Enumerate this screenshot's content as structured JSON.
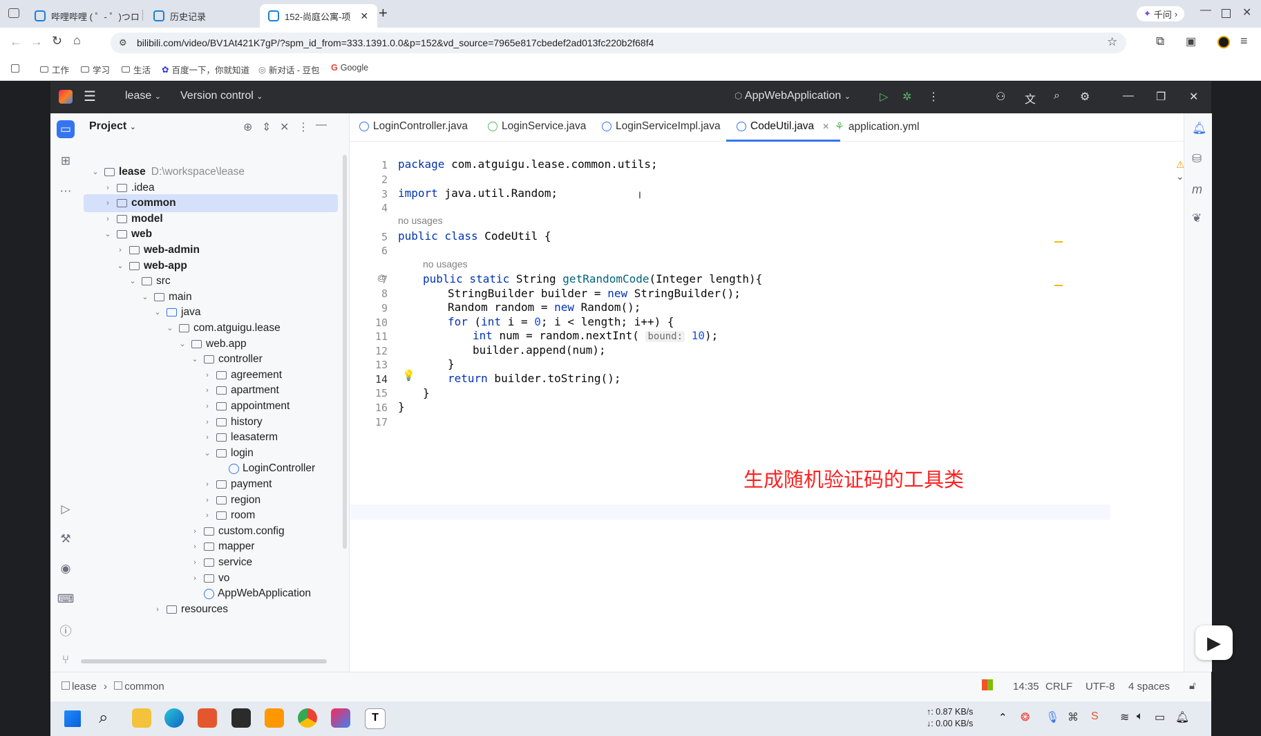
{
  "browser": {
    "tabs": [
      {
        "label": "哔哩哔哩 ( ゜- ゜)つロ",
        "active": false
      },
      {
        "label": "历史记录",
        "active": false
      },
      {
        "label": "152-尚庭公寓-项",
        "active": true
      }
    ],
    "new_tab": "+",
    "assistant_label": "千问",
    "url": "bilibili.com/video/BV1At421K7gP/?spm_id_from=333.1391.0.0&p=152&vd_source=7965e817cbedef2ad013fc220b2f68f4",
    "bookmarks": [
      "工作",
      "学习",
      "生活",
      "百度一下，你就知道",
      "新对话 - 豆包",
      "Google"
    ]
  },
  "ide": {
    "project_name": "lease",
    "vcs_label": "Version control",
    "run_config": "AppWebApplication",
    "project_panel_title": "Project",
    "tree": [
      {
        "label": "lease",
        "extra": "D:\\workspace\\lease",
        "depth": 0,
        "type": "module",
        "open": true,
        "bold": true
      },
      {
        "label": ".idea",
        "depth": 1,
        "type": "folder",
        "open": false
      },
      {
        "label": "common",
        "depth": 1,
        "type": "module",
        "open": false,
        "bold": true,
        "selected": true
      },
      {
        "label": "model",
        "depth": 1,
        "type": "module",
        "open": false,
        "bold": true
      },
      {
        "label": "web",
        "depth": 1,
        "type": "module",
        "open": true,
        "bold": true
      },
      {
        "label": "web-admin",
        "depth": 2,
        "type": "module",
        "open": false,
        "bold": true
      },
      {
        "label": "web-app",
        "depth": 2,
        "type": "module",
        "open": true,
        "bold": true
      },
      {
        "label": "src",
        "depth": 3,
        "type": "folder",
        "open": true
      },
      {
        "label": "main",
        "depth": 4,
        "type": "folder",
        "open": true
      },
      {
        "label": "java",
        "depth": 5,
        "type": "folder",
        "open": true
      },
      {
        "label": "com.atguigu.lease",
        "depth": 6,
        "type": "package",
        "open": true
      },
      {
        "label": "web.app",
        "depth": 7,
        "type": "package",
        "open": true
      },
      {
        "label": "controller",
        "depth": 8,
        "type": "package",
        "open": true
      },
      {
        "label": "agreement",
        "depth": 9,
        "type": "package",
        "open": false
      },
      {
        "label": "apartment",
        "depth": 9,
        "type": "package",
        "open": false
      },
      {
        "label": "appointment",
        "depth": 9,
        "type": "package",
        "open": false
      },
      {
        "label": "history",
        "depth": 9,
        "type": "package",
        "open": false
      },
      {
        "label": "leasaterm",
        "depth": 9,
        "type": "package",
        "open": false
      },
      {
        "label": "login",
        "depth": 9,
        "type": "package",
        "open": true
      },
      {
        "label": "LoginController",
        "depth": 10,
        "type": "class",
        "open": null
      },
      {
        "label": "payment",
        "depth": 9,
        "type": "package",
        "open": false
      },
      {
        "label": "region",
        "depth": 9,
        "type": "package",
        "open": false
      },
      {
        "label": "room",
        "depth": 9,
        "type": "package",
        "open": false
      },
      {
        "label": "custom.config",
        "depth": 8,
        "type": "package",
        "open": false
      },
      {
        "label": "mapper",
        "depth": 8,
        "type": "package",
        "open": false
      },
      {
        "label": "service",
        "depth": 8,
        "type": "package",
        "open": false
      },
      {
        "label": "vo",
        "depth": 8,
        "type": "package",
        "open": false
      },
      {
        "label": "AppWebApplication",
        "depth": 8,
        "type": "class",
        "open": null
      },
      {
        "label": "resources",
        "depth": 5,
        "type": "folder",
        "open": false
      }
    ],
    "editor_tabs": [
      {
        "label": "LoginController.java",
        "active": false
      },
      {
        "label": "LoginService.java",
        "active": false
      },
      {
        "label": "LoginServiceImpl.java",
        "active": false
      },
      {
        "label": "CodeUtil.java",
        "active": true
      },
      {
        "label": "application.yml",
        "active": false
      }
    ],
    "warnings_count": "2",
    "code": {
      "l1": {
        "kw": "package",
        "rest": " com.atguigu.lease.common.utils;"
      },
      "l3": {
        "kw": "import",
        "rest": " java.util.Random;"
      },
      "usages1": "no usages",
      "l5": {
        "kw": "public class",
        "name": " CodeUtil",
        "rest": " {"
      },
      "usages2": "no usages",
      "l7": {
        "kw": "public static",
        "rest1": " String ",
        "method": "getRandomCode",
        "rest2": "(Integer length){"
      },
      "l8": {
        "a": "StringBuilder builder = ",
        "kw": "new",
        "b": " StringBuilder();"
      },
      "l9": {
        "a": "Random random = ",
        "kw": "new",
        "b": " Random();"
      },
      "l10": {
        "kw": "for",
        "a": " (",
        "kw2": "int",
        "b": " i = ",
        "num": "0",
        "c": "; i < length; i++) {"
      },
      "l11": {
        "kw": "int",
        "a": " num = random.nextInt(",
        "hint": "bound:",
        "num": "10",
        "b": ");"
      },
      "l12": "builder.append(num);",
      "l13": "}",
      "l14": {
        "kw": "return",
        "rest": " builder.toString();"
      },
      "l15": "}",
      "l16": "}"
    },
    "line_numbers": [
      "1",
      "2",
      "3",
      "4",
      "5",
      "6",
      "7",
      "8",
      "9",
      "10",
      "11",
      "12",
      "13",
      "14",
      "15",
      "16",
      "17"
    ],
    "overlay_caption": "生成随机验证码的工具类",
    "breadcrumb": [
      "lease",
      "common"
    ],
    "status": {
      "position": "14:35",
      "line_sep": "CRLF",
      "encoding": "UTF-8",
      "indent": "4 spaces"
    }
  },
  "taskbar": {
    "net_up": "↑: 0.87 KB/s",
    "net_down": "↓: 0.00 KB/s"
  }
}
